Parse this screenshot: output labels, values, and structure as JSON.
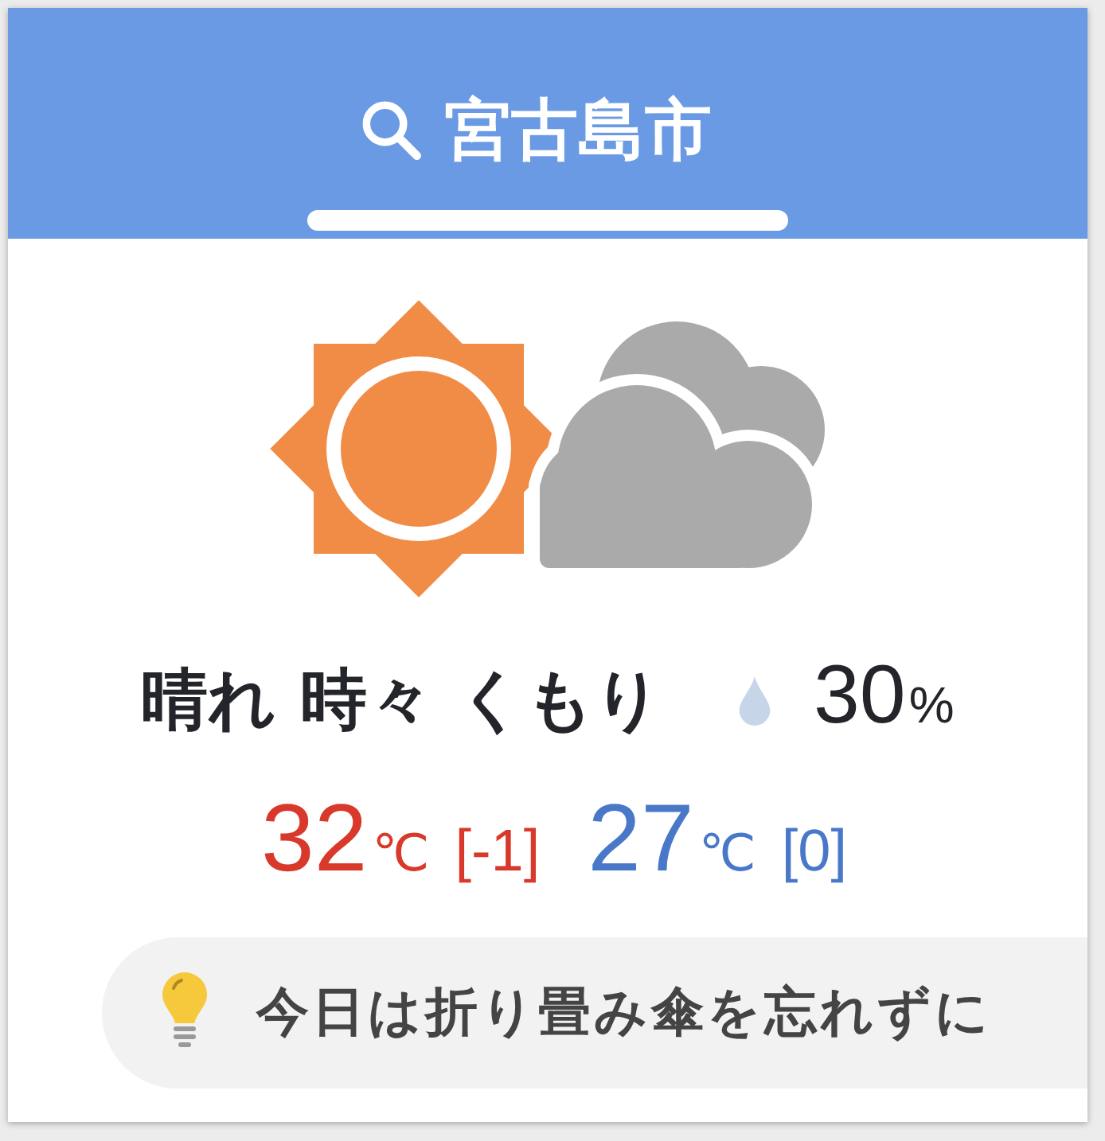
{
  "header": {
    "location": "宮古島市"
  },
  "forecast": {
    "condition": "晴れ 時々 くもり",
    "precipitation": {
      "value": "30",
      "unit": "%"
    },
    "temperatures": [
      {
        "value": "32",
        "unit": "℃",
        "diff": "[-1]",
        "color": "#d8392b"
      },
      {
        "value": "27",
        "unit": "℃",
        "diff": "[0]",
        "color": "#4a78c9"
      }
    ]
  },
  "tip": {
    "text": "今日は折り畳み傘を忘れずに"
  }
}
